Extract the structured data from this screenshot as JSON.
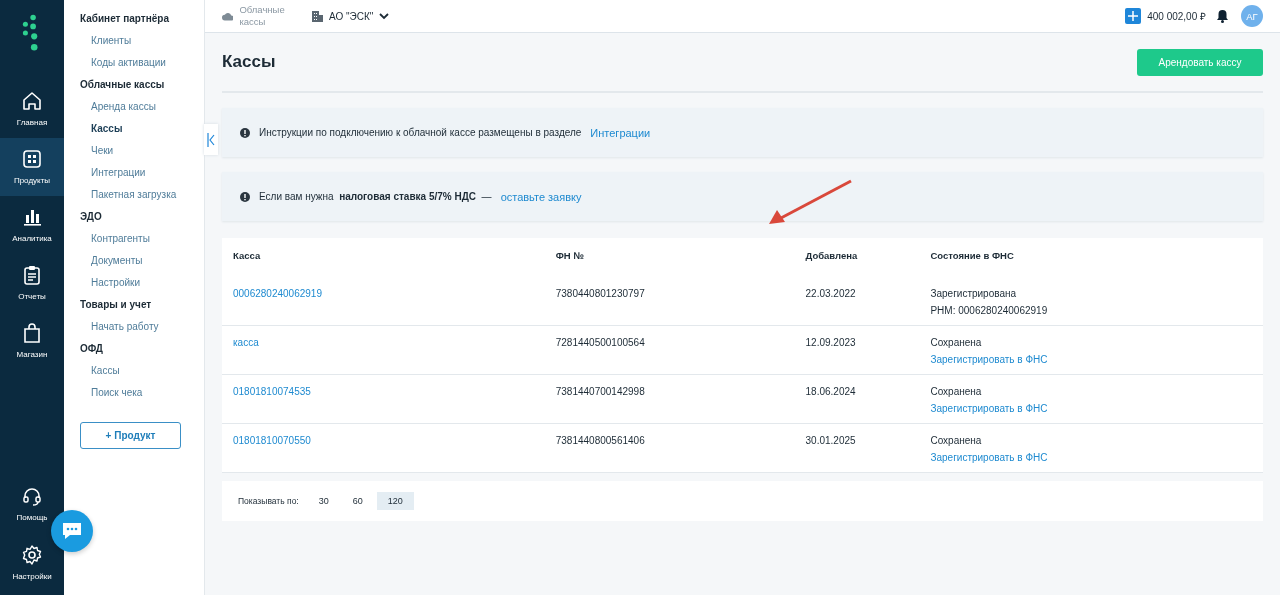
{
  "rail": [
    {
      "label": "Главная",
      "selected": false
    },
    {
      "label": "Продукты",
      "selected": true
    },
    {
      "label": "Аналитика",
      "selected": false
    },
    {
      "label": "Отчеты",
      "selected": false
    },
    {
      "label": "Магазин",
      "selected": false
    }
  ],
  "rail_bottom": [
    {
      "label": "Помощь"
    },
    {
      "label": "Настройки"
    }
  ],
  "menu": [
    {
      "title": "Кабинет партнёра",
      "items": [
        {
          "label": "Клиенты",
          "selected": false
        },
        {
          "label": "Коды активации",
          "selected": false
        }
      ]
    },
    {
      "title": "Облачные кассы",
      "items": [
        {
          "label": "Аренда кассы",
          "selected": false
        },
        {
          "label": "Кассы",
          "selected": true
        },
        {
          "label": "Чеки",
          "selected": false
        },
        {
          "label": "Интеграции",
          "selected": false
        },
        {
          "label": "Пакетная загрузка",
          "selected": false
        }
      ]
    },
    {
      "title": "ЭДО",
      "items": [
        {
          "label": "Контрагенты",
          "selected": false
        },
        {
          "label": "Документы",
          "selected": false
        },
        {
          "label": "Настройки",
          "selected": false
        }
      ]
    },
    {
      "title": "Товары и учет",
      "items": [
        {
          "label": "Начать работу",
          "selected": false
        }
      ]
    },
    {
      "title": "ОФД",
      "items": [
        {
          "label": "Кассы",
          "selected": false
        },
        {
          "label": "Поиск чека",
          "selected": false
        }
      ]
    }
  ],
  "add_product_button": "+ Продукт",
  "topbar": {
    "service": "Облачные кассы",
    "company": "АО \"ЭСК\"",
    "balance": "400 002,00 ₽",
    "avatar": "АГ"
  },
  "page_title": "Кассы",
  "rent_button": "Арендовать кассу",
  "notices": [
    {
      "text": "Инструкции по подключению к облачной кассе размещены в разделе",
      "link": "Интеграции"
    },
    {
      "text": "Если вам нужна  **налоговая ставка 5/7% НДС**  —",
      "link": "оставьте заявку"
    }
  ],
  "table": {
    "columns": [
      "Касса",
      "ФН №",
      "Добавлена",
      "Состояние в ФНС"
    ],
    "rows": [
      {
        "kassa": "0006280240062919",
        "fn": "7380440801230797",
        "added": "22.03.2022",
        "status": "Зарегистрирована",
        "detail": {
          "kind": "text",
          "text": "РНМ: 0006280240062919"
        }
      },
      {
        "kassa": "касса",
        "fn": "7281440500100564",
        "added": "12.09.2023",
        "status": "Сохранена",
        "detail": {
          "kind": "link",
          "text": "Зарегистрировать в ФНС"
        }
      },
      {
        "kassa": "01801810074535",
        "fn": "7381440700142998",
        "added": "18.06.2024",
        "status": "Сохранена",
        "detail": {
          "kind": "link",
          "text": "Зарегистрировать в ФНС"
        }
      },
      {
        "kassa": "01801810070550",
        "fn": "7381440800561406",
        "added": "30.01.2025",
        "status": "Сохранена",
        "detail": {
          "kind": "link",
          "text": "Зарегистрировать в ФНС"
        }
      }
    ]
  },
  "pagination": {
    "label": "Показывать по:",
    "options": [
      {
        "label": "30",
        "selected": false
      },
      {
        "label": "60",
        "selected": false
      },
      {
        "label": "120",
        "selected": true
      }
    ]
  }
}
